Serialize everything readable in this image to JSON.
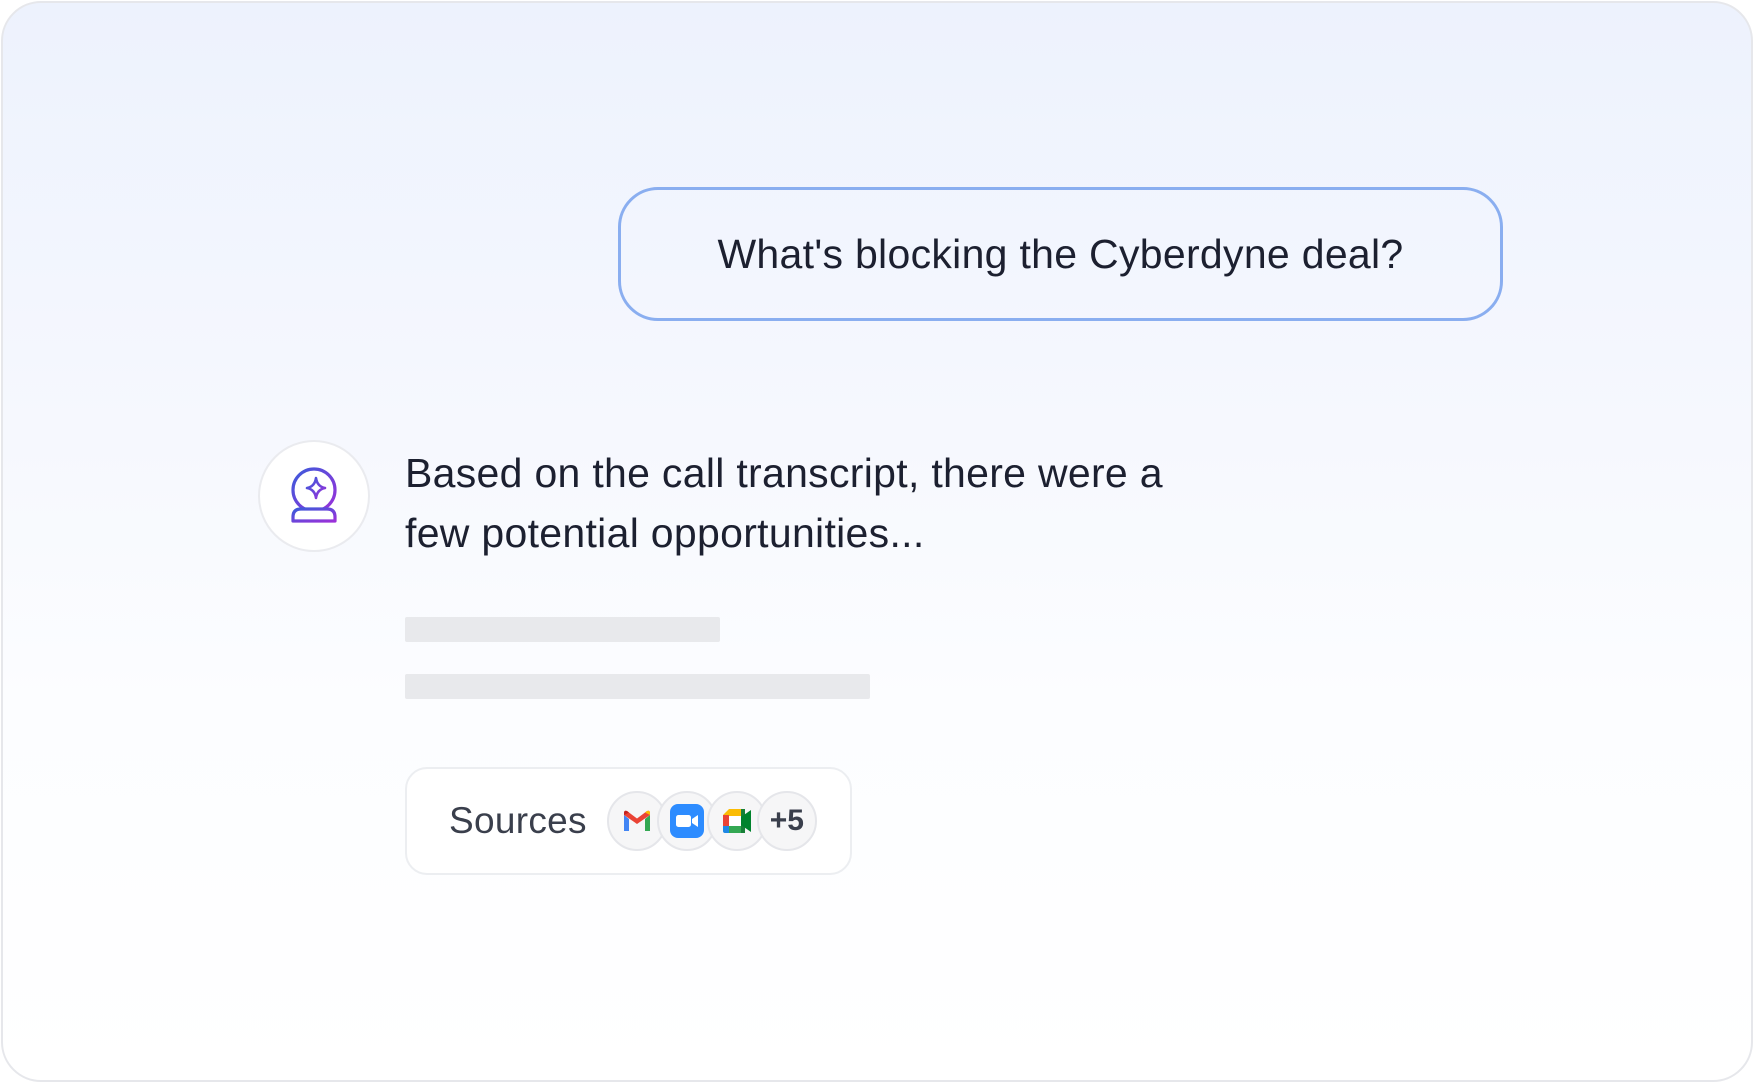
{
  "conversation": {
    "user_message": "What's blocking the Cyberdyne deal?",
    "assistant": {
      "avatar_icon": "crystal-ball-sparkle-icon",
      "answer_line_1": "Based on the call transcript, there were a",
      "answer_line_2": "few potential opportunities...",
      "placeholder_lines": 2
    },
    "sources": {
      "label": "Sources",
      "icons": [
        "gmail-icon",
        "zoom-icon",
        "google-meet-icon"
      ],
      "more_count": "+5"
    }
  },
  "colors": {
    "bubble_border": "#8aaef0",
    "text": "#1c2030",
    "avatar_gradient_start": "#3b5bdb",
    "avatar_gradient_end": "#9b30d9"
  }
}
